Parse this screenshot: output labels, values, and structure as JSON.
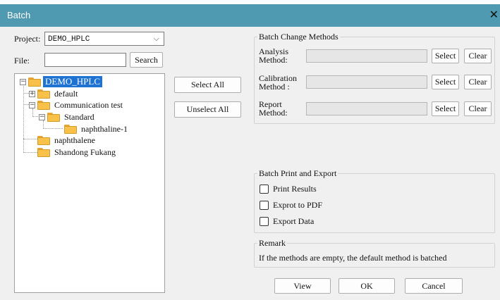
{
  "window": {
    "title": "Batch",
    "close_glyph": "✕"
  },
  "project": {
    "label": "Project:",
    "value": "DEMO_HPLC",
    "arrow": "⌵"
  },
  "file": {
    "label": "File:",
    "value": "",
    "search_label": "Search"
  },
  "tree": {
    "root": "DEMO_HPLC",
    "nodes": [
      "default",
      "Communication test",
      "Standard",
      "naphthaline-1",
      "naphthalene",
      "Shandong Fukang"
    ]
  },
  "selection": {
    "select_all": "Select All",
    "unselect_all": "Unselect All"
  },
  "batch_change": {
    "title": "Batch Change Methods",
    "rows": [
      {
        "line1": "Analysis",
        "line2": "Method:",
        "value": "",
        "select": "Select",
        "clear": "Clear"
      },
      {
        "line1": "Calibration",
        "line2": "Method :",
        "value": "",
        "select": "Select",
        "clear": "Clear"
      },
      {
        "line1": "Report",
        "line2": "Method:",
        "value": "",
        "select": "Select",
        "clear": "Clear"
      }
    ]
  },
  "print_export": {
    "title": "Batch Print and Export",
    "options": [
      {
        "label": "Print Results",
        "checked": false
      },
      {
        "label": "Exprot to PDF",
        "checked": false
      },
      {
        "label": "Export Data",
        "checked": false
      }
    ]
  },
  "remark": {
    "title": "Remark",
    "text": "If the methods are empty, the default method is batched"
  },
  "footer": {
    "view": "View",
    "ok": "OK",
    "cancel": "Cancel"
  }
}
